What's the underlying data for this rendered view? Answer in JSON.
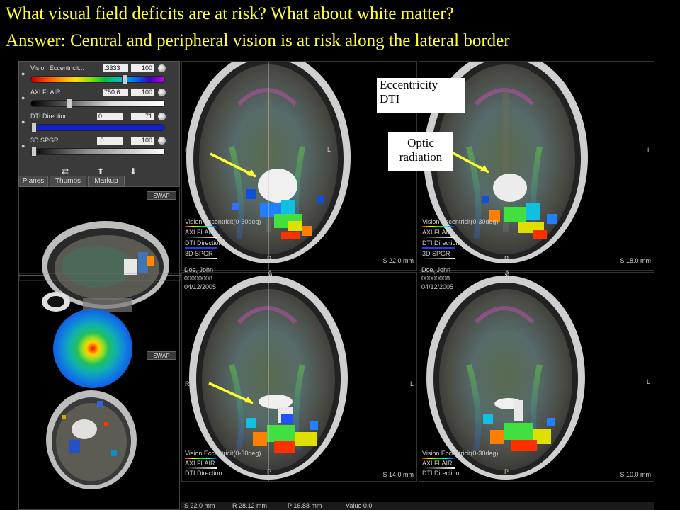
{
  "slide": {
    "question": "What visual field deficits are at risk? What about white matter?",
    "answer": "Answer: Central and peripheral vision is at risk along the lateral border"
  },
  "annotations": {
    "eccentricity_line1": "Eccentricity",
    "eccentricity_line2": "DTI",
    "optic_line1": "Optic",
    "optic_line2": "radiation"
  },
  "layers": [
    {
      "name": "Vision Eccentricit...",
      "value": ".3333",
      "max": "100"
    },
    {
      "name": "AXI FLAIR",
      "value": "750.6",
      "max": "100"
    },
    {
      "name": "DTI Direction",
      "value": "0",
      "max": "71"
    },
    {
      "name": "3D SPGR",
      "value": ".0",
      "max": "100"
    }
  ],
  "tabs": [
    "Planes",
    "Thumbs",
    "Markup"
  ],
  "swap_label": "SWAP",
  "legend": {
    "l1": "Vision Eccentricit(0-30deg)",
    "l2": "AXI FLAIR",
    "l3": "DTI Direction",
    "l4": "3D SPGR"
  },
  "patient": {
    "name": "Doe, John",
    "id": "00000008",
    "date": "04/12/2005"
  },
  "orientation": {
    "r": "R",
    "l": "L",
    "p": "P",
    "a": "A"
  },
  "slices": [
    "S 22.0 mm",
    "S 18.0 mm",
    "S 14.0 mm",
    "S 10.0 mm"
  ],
  "status": {
    "s": "S 22.0 mm",
    "r": "R 28.12 mm",
    "p": "P 16.88 mm",
    "value": "Value  0.0"
  },
  "colors": {
    "title": "#ffff33",
    "arrow": "#ffff33"
  }
}
